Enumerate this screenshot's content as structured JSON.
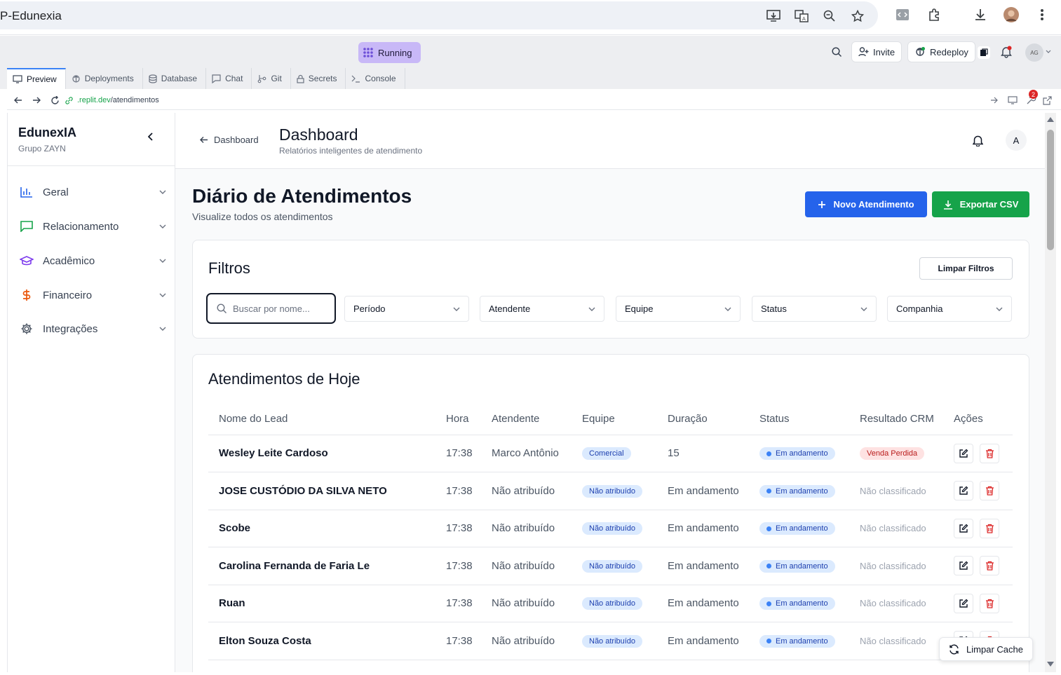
{
  "browser": {
    "tab_title": "P-Edunexia",
    "badge_count": "2"
  },
  "replit": {
    "status_label": "Running",
    "invite_label": "Invite",
    "redeploy_label": "Redeploy",
    "avatar_initials": "AG",
    "tabs": [
      {
        "label": "Preview",
        "icon": "monitor-icon"
      },
      {
        "label": "Deployments",
        "icon": "deploy-icon"
      },
      {
        "label": "Database",
        "icon": "database-icon"
      },
      {
        "label": "Chat",
        "icon": "chat-icon"
      },
      {
        "label": "Git",
        "icon": "git-icon"
      },
      {
        "label": "Secrets",
        "icon": "lock-icon"
      },
      {
        "label": "Console",
        "icon": "terminal-icon"
      }
    ],
    "url_domain": ".replit.dev",
    "url_path": "/atendimentos"
  },
  "sidebar": {
    "brand": "EdunexIA",
    "org": "Grupo ZAYN",
    "items": [
      {
        "label": "Geral",
        "icon": "chart-icon",
        "color": "#2563eb"
      },
      {
        "label": "Relacionamento",
        "icon": "message-icon",
        "color": "#16a34a"
      },
      {
        "label": "Acadêmico",
        "icon": "graduation-cap-icon",
        "color": "#7c3aed"
      },
      {
        "label": "Financeiro",
        "icon": "dollar-icon",
        "color": "#ea580c"
      },
      {
        "label": "Integrações",
        "icon": "gear-icon",
        "color": "#4b5563"
      }
    ]
  },
  "header": {
    "back_label": "Dashboard",
    "title": "Dashboard",
    "subtitle": "Relatórios inteligentes de atendimento",
    "user_initial": "A"
  },
  "page": {
    "title": "Diário de Atendimentos",
    "subtitle": "Visualize todos os atendimentos",
    "new_button": "Novo Atendimento",
    "export_button": "Exportar CSV"
  },
  "filters": {
    "title": "Filtros",
    "clear_label": "Limpar Filtros",
    "search_placeholder": "Buscar por nome...",
    "selects": [
      "Período",
      "Atendente",
      "Equipe",
      "Status",
      "Companhia"
    ]
  },
  "table": {
    "title": "Atendimentos de Hoje",
    "columns": [
      "Nome do Lead",
      "Hora",
      "Atendente",
      "Equipe",
      "Duração",
      "Status",
      "Resultado CRM",
      "Ações"
    ],
    "rows": [
      {
        "name": "Wesley Leite Cardoso",
        "hora": "17:38",
        "atendente": "Marco Antônio",
        "equipe": "Comercial",
        "duracao": "15",
        "status": "Em andamento",
        "crm": "Venda Perdida"
      },
      {
        "name": "JOSE CUSTÓDIO DA SILVA NETO",
        "hora": "17:38",
        "atendente": "Não atribuído",
        "equipe": "Não atribuído",
        "duracao": "Em andamento",
        "status": "Em andamento",
        "crm": "Não classificado"
      },
      {
        "name": "Scobe",
        "hora": "17:38",
        "atendente": "Não atribuído",
        "equipe": "Não atribuído",
        "duracao": "Em andamento",
        "status": "Em andamento",
        "crm": "Não classificado"
      },
      {
        "name": "Carolina Fernanda de Faria Le",
        "hora": "17:38",
        "atendente": "Não atribuído",
        "equipe": "Não atribuído",
        "duracao": "Em andamento",
        "status": "Em andamento",
        "crm": "Não classificado"
      },
      {
        "name": "Ruan",
        "hora": "17:38",
        "atendente": "Não atribuído",
        "equipe": "Não atribuído",
        "duracao": "Em andamento",
        "status": "Em andamento",
        "crm": "Não classificado"
      },
      {
        "name": "Elton Souza Costa",
        "hora": "17:38",
        "atendente": "Não atribuído",
        "equipe": "Não atribuído",
        "duracao": "Em andamento",
        "status": "Em andamento",
        "crm": "Não classificado"
      }
    ]
  },
  "cache_button": "Limpar Cache",
  "colors": {
    "primary": "#2563eb",
    "success": "#16a34a",
    "danger": "#dc2626",
    "running": "#c8b8f7"
  }
}
